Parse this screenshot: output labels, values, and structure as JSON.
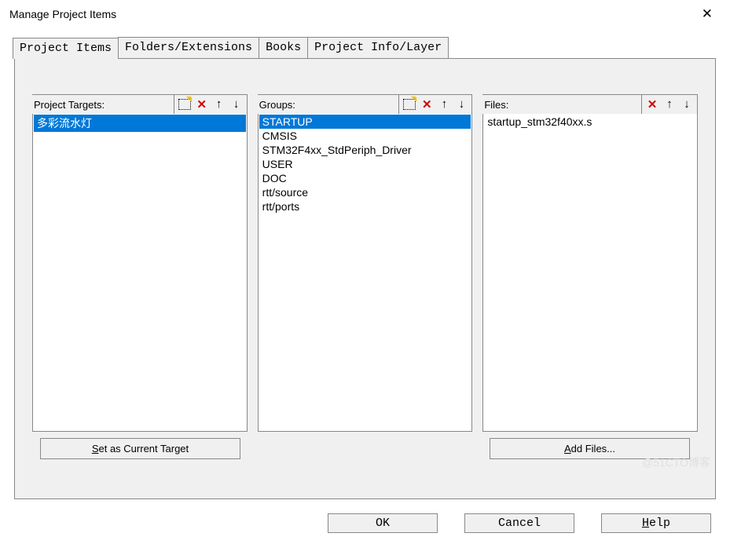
{
  "window": {
    "title": "Manage Project Items"
  },
  "tabs": [
    {
      "label": "Project Items",
      "active": true
    },
    {
      "label": "Folders/Extensions"
    },
    {
      "label": "Books"
    },
    {
      "label": "Project Info/Layer"
    }
  ],
  "columns": {
    "targets": {
      "label": "Project Targets:",
      "items": [
        "多彩流水灯"
      ],
      "selected": 0,
      "button": "Set as Current Target"
    },
    "groups": {
      "label": "Groups:",
      "items": [
        "STARTUP",
        "CMSIS",
        "STM32F4xx_StdPeriph_Driver",
        "USER",
        "DOC",
        "rtt/source",
        "rtt/ports"
      ],
      "selected": 0
    },
    "files": {
      "label": "Files:",
      "items": [
        "startup_stm32f40xx.s"
      ],
      "selected": -1,
      "button": "Add Files..."
    }
  },
  "buttons": {
    "ok": "OK",
    "cancel": "Cancel",
    "help": "Help"
  },
  "watermark": "@51CTO博客"
}
